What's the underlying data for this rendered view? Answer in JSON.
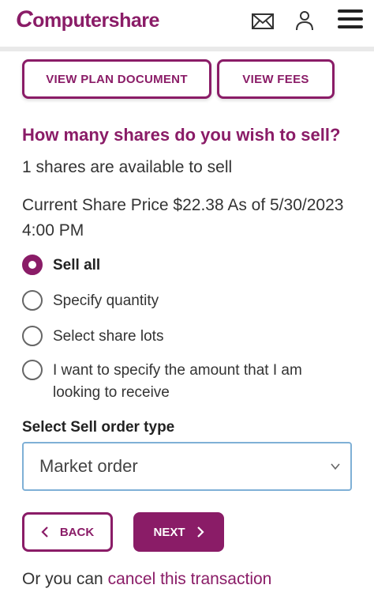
{
  "header": {
    "logo_c": "C",
    "logo_rest": "omputershare",
    "icons": [
      "mail-icon",
      "user-icon",
      "menu-icon"
    ]
  },
  "top_buttons": {
    "plan": "VIEW PLAN DOCUMENT",
    "fees": "VIEW FEES"
  },
  "question": "How many shares do you wish to sell?",
  "available": "1 shares are available to sell",
  "price": "Current Share Price $22.38 As of 5/30/2023 4:00 PM",
  "options": [
    {
      "label": "Sell all",
      "selected": true
    },
    {
      "label": "Specify quantity",
      "selected": false
    },
    {
      "label": "Select share lots",
      "selected": false
    },
    {
      "label": "I want to specify the amount that I am looking to receive",
      "selected": false
    }
  ],
  "order_type": {
    "label": "Select Sell order type",
    "value": "Market order"
  },
  "nav": {
    "back": "BACK",
    "next": "NEXT"
  },
  "cancel": {
    "prefix": "Or you can ",
    "link": "cancel this transaction"
  },
  "colors": {
    "brand": "#8a1c67",
    "select_border": "#7fb0d6"
  }
}
